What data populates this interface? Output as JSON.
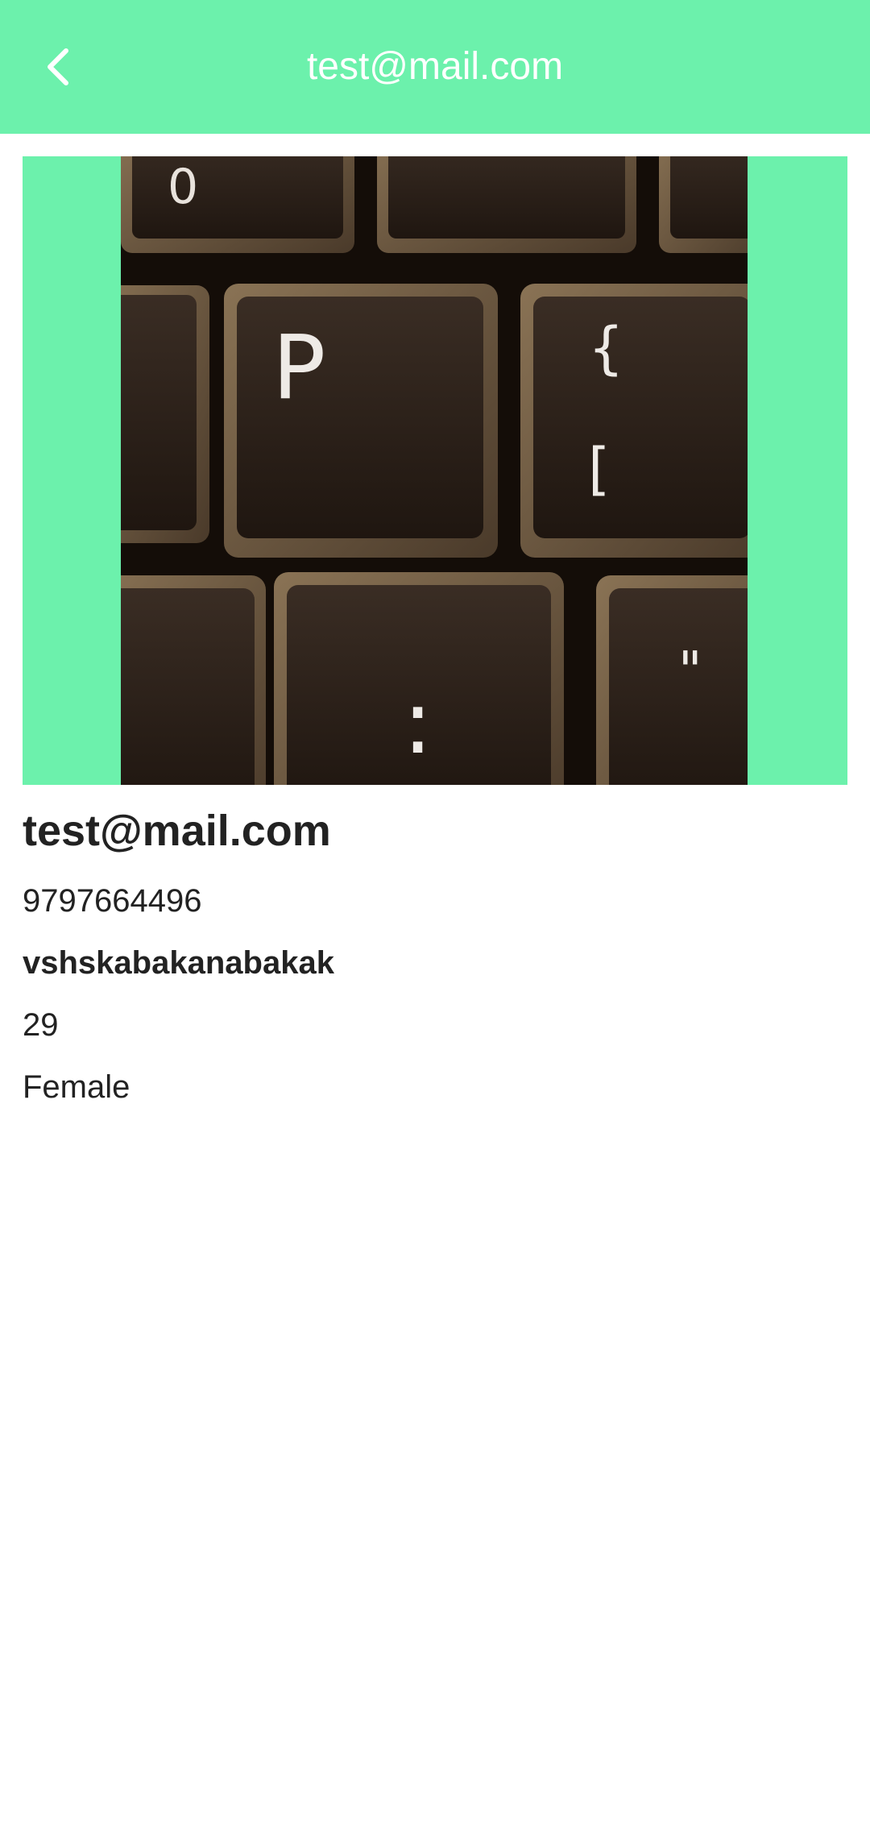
{
  "header": {
    "title": "test@mail.com",
    "back_icon": "chevron-left-icon"
  },
  "colors": {
    "accent": "#6cf1ac",
    "text": "#222222",
    "header_text": "#ffffff"
  },
  "profile": {
    "photo": {
      "subject": "keyboard-keys-photo",
      "keys": [
        "P",
        "{",
        "[",
        "0",
        "\"",
        ":"
      ]
    },
    "email": "test@mail.com",
    "phone": "9797664496",
    "name": "vshskabakanabakak",
    "age": "29",
    "gender": "Female"
  }
}
